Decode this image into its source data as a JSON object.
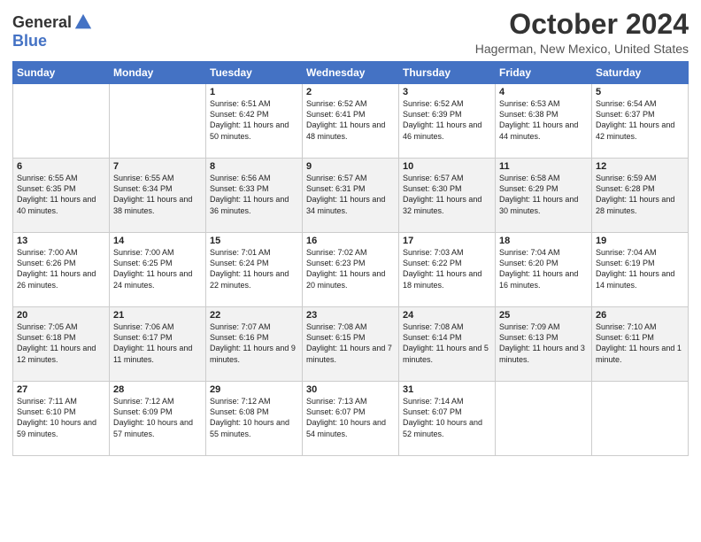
{
  "header": {
    "logo_general": "General",
    "logo_blue": "Blue",
    "month_title": "October 2024",
    "location": "Hagerman, New Mexico, United States"
  },
  "weekdays": [
    "Sunday",
    "Monday",
    "Tuesday",
    "Wednesday",
    "Thursday",
    "Friday",
    "Saturday"
  ],
  "weeks": [
    [
      {
        "day": "",
        "info": ""
      },
      {
        "day": "",
        "info": ""
      },
      {
        "day": "1",
        "info": "Sunrise: 6:51 AM\nSunset: 6:42 PM\nDaylight: 11 hours and 50 minutes."
      },
      {
        "day": "2",
        "info": "Sunrise: 6:52 AM\nSunset: 6:41 PM\nDaylight: 11 hours and 48 minutes."
      },
      {
        "day": "3",
        "info": "Sunrise: 6:52 AM\nSunset: 6:39 PM\nDaylight: 11 hours and 46 minutes."
      },
      {
        "day": "4",
        "info": "Sunrise: 6:53 AM\nSunset: 6:38 PM\nDaylight: 11 hours and 44 minutes."
      },
      {
        "day": "5",
        "info": "Sunrise: 6:54 AM\nSunset: 6:37 PM\nDaylight: 11 hours and 42 minutes."
      }
    ],
    [
      {
        "day": "6",
        "info": "Sunrise: 6:55 AM\nSunset: 6:35 PM\nDaylight: 11 hours and 40 minutes."
      },
      {
        "day": "7",
        "info": "Sunrise: 6:55 AM\nSunset: 6:34 PM\nDaylight: 11 hours and 38 minutes."
      },
      {
        "day": "8",
        "info": "Sunrise: 6:56 AM\nSunset: 6:33 PM\nDaylight: 11 hours and 36 minutes."
      },
      {
        "day": "9",
        "info": "Sunrise: 6:57 AM\nSunset: 6:31 PM\nDaylight: 11 hours and 34 minutes."
      },
      {
        "day": "10",
        "info": "Sunrise: 6:57 AM\nSunset: 6:30 PM\nDaylight: 11 hours and 32 minutes."
      },
      {
        "day": "11",
        "info": "Sunrise: 6:58 AM\nSunset: 6:29 PM\nDaylight: 11 hours and 30 minutes."
      },
      {
        "day": "12",
        "info": "Sunrise: 6:59 AM\nSunset: 6:28 PM\nDaylight: 11 hours and 28 minutes."
      }
    ],
    [
      {
        "day": "13",
        "info": "Sunrise: 7:00 AM\nSunset: 6:26 PM\nDaylight: 11 hours and 26 minutes."
      },
      {
        "day": "14",
        "info": "Sunrise: 7:00 AM\nSunset: 6:25 PM\nDaylight: 11 hours and 24 minutes."
      },
      {
        "day": "15",
        "info": "Sunrise: 7:01 AM\nSunset: 6:24 PM\nDaylight: 11 hours and 22 minutes."
      },
      {
        "day": "16",
        "info": "Sunrise: 7:02 AM\nSunset: 6:23 PM\nDaylight: 11 hours and 20 minutes."
      },
      {
        "day": "17",
        "info": "Sunrise: 7:03 AM\nSunset: 6:22 PM\nDaylight: 11 hours and 18 minutes."
      },
      {
        "day": "18",
        "info": "Sunrise: 7:04 AM\nSunset: 6:20 PM\nDaylight: 11 hours and 16 minutes."
      },
      {
        "day": "19",
        "info": "Sunrise: 7:04 AM\nSunset: 6:19 PM\nDaylight: 11 hours and 14 minutes."
      }
    ],
    [
      {
        "day": "20",
        "info": "Sunrise: 7:05 AM\nSunset: 6:18 PM\nDaylight: 11 hours and 12 minutes."
      },
      {
        "day": "21",
        "info": "Sunrise: 7:06 AM\nSunset: 6:17 PM\nDaylight: 11 hours and 11 minutes."
      },
      {
        "day": "22",
        "info": "Sunrise: 7:07 AM\nSunset: 6:16 PM\nDaylight: 11 hours and 9 minutes."
      },
      {
        "day": "23",
        "info": "Sunrise: 7:08 AM\nSunset: 6:15 PM\nDaylight: 11 hours and 7 minutes."
      },
      {
        "day": "24",
        "info": "Sunrise: 7:08 AM\nSunset: 6:14 PM\nDaylight: 11 hours and 5 minutes."
      },
      {
        "day": "25",
        "info": "Sunrise: 7:09 AM\nSunset: 6:13 PM\nDaylight: 11 hours and 3 minutes."
      },
      {
        "day": "26",
        "info": "Sunrise: 7:10 AM\nSunset: 6:11 PM\nDaylight: 11 hours and 1 minute."
      }
    ],
    [
      {
        "day": "27",
        "info": "Sunrise: 7:11 AM\nSunset: 6:10 PM\nDaylight: 10 hours and 59 minutes."
      },
      {
        "day": "28",
        "info": "Sunrise: 7:12 AM\nSunset: 6:09 PM\nDaylight: 10 hours and 57 minutes."
      },
      {
        "day": "29",
        "info": "Sunrise: 7:12 AM\nSunset: 6:08 PM\nDaylight: 10 hours and 55 minutes."
      },
      {
        "day": "30",
        "info": "Sunrise: 7:13 AM\nSunset: 6:07 PM\nDaylight: 10 hours and 54 minutes."
      },
      {
        "day": "31",
        "info": "Sunrise: 7:14 AM\nSunset: 6:07 PM\nDaylight: 10 hours and 52 minutes."
      },
      {
        "day": "",
        "info": ""
      },
      {
        "day": "",
        "info": ""
      }
    ]
  ]
}
